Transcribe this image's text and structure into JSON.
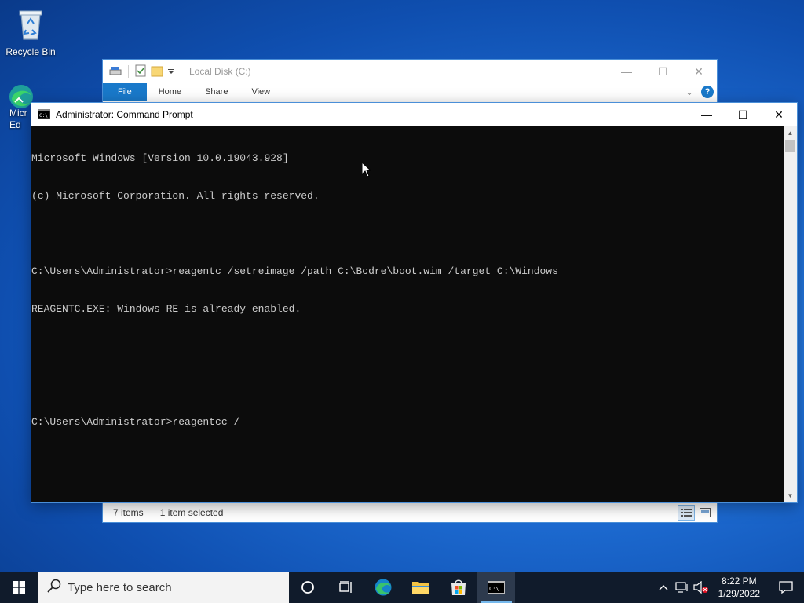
{
  "desktop": {
    "icons": [
      {
        "label": "Recycle Bin",
        "icon": "recycle-bin-icon"
      },
      {
        "label": "Micr\nEd",
        "icon": "edge-icon"
      }
    ]
  },
  "explorer": {
    "title": "Local Disk (C:)",
    "tabs": [
      "File",
      "Home",
      "Share",
      "View"
    ],
    "help_label": "?",
    "status": {
      "items_count": "7 items",
      "selected": "1 item selected"
    }
  },
  "cmd": {
    "title": "Administrator: Command Prompt",
    "lines": [
      "Microsoft Windows [Version 10.0.19043.928]",
      "(c) Microsoft Corporation. All rights reserved.",
      "",
      "C:\\Users\\Administrator>reagentc /setreimage /path C:\\Bcdre\\boot.wim /target C:\\Windows",
      "REAGENTC.EXE: Windows RE is already enabled.",
      "",
      "",
      "C:\\Users\\Administrator>reagentcc /"
    ]
  },
  "taskbar": {
    "search_placeholder": "Type here to search",
    "time": "8:22 PM",
    "date": "1/29/2022"
  },
  "colors": {
    "accent": "#1979ca",
    "taskbar": "#101b2b",
    "console_bg": "#0c0c0c",
    "console_fg": "#cccccc"
  }
}
